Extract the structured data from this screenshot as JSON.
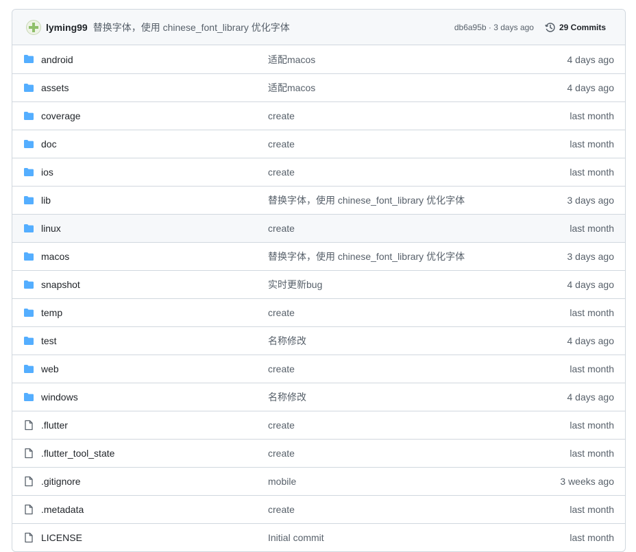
{
  "header": {
    "author": "lyming99",
    "commit_message": "替换字体，使用 chinese_font_library 优化字体",
    "sha": "db6a95b",
    "separator": " · ",
    "time": "3 days ago",
    "commits_label": "29 Commits"
  },
  "files": [
    {
      "name": "android",
      "type": "folder",
      "commit": "适配macos",
      "age": "4 days ago"
    },
    {
      "name": "assets",
      "type": "folder",
      "commit": "适配macos",
      "age": "4 days ago"
    },
    {
      "name": "coverage",
      "type": "folder",
      "commit": "create",
      "age": "last month"
    },
    {
      "name": "doc",
      "type": "folder",
      "commit": "create",
      "age": "last month"
    },
    {
      "name": "ios",
      "type": "folder",
      "commit": "create",
      "age": "last month"
    },
    {
      "name": "lib",
      "type": "folder",
      "commit": "替换字体，使用 chinese_font_library 优化字体",
      "age": "3 days ago"
    },
    {
      "name": "linux",
      "type": "folder",
      "commit": "create",
      "age": "last month"
    },
    {
      "name": "macos",
      "type": "folder",
      "commit": "替换字体，使用 chinese_font_library 优化字体",
      "age": "3 days ago"
    },
    {
      "name": "snapshot",
      "type": "folder",
      "commit": "实时更新bug",
      "age": "4 days ago"
    },
    {
      "name": "temp",
      "type": "folder",
      "commit": "create",
      "age": "last month"
    },
    {
      "name": "test",
      "type": "folder",
      "commit": "名称修改",
      "age": "4 days ago"
    },
    {
      "name": "web",
      "type": "folder",
      "commit": "create",
      "age": "last month"
    },
    {
      "name": "windows",
      "type": "folder",
      "commit": "名称修改",
      "age": "4 days ago"
    },
    {
      "name": ".flutter",
      "type": "file",
      "commit": "create",
      "age": "last month"
    },
    {
      "name": ".flutter_tool_state",
      "type": "file",
      "commit": "create",
      "age": "last month"
    },
    {
      "name": ".gitignore",
      "type": "file",
      "commit": "mobile",
      "age": "3 weeks ago"
    },
    {
      "name": ".metadata",
      "type": "file",
      "commit": "create",
      "age": "last month"
    },
    {
      "name": "LICENSE",
      "type": "file",
      "commit": "Initial commit",
      "age": "last month"
    }
  ],
  "colors": {
    "folder": "#54aeff",
    "file": "#57606a",
    "border": "#d0d7de",
    "header_bg": "#f6f8fa"
  },
  "icons": {
    "folder": "folder-icon",
    "file": "file-icon",
    "history": "history-icon",
    "avatar": "avatar"
  }
}
